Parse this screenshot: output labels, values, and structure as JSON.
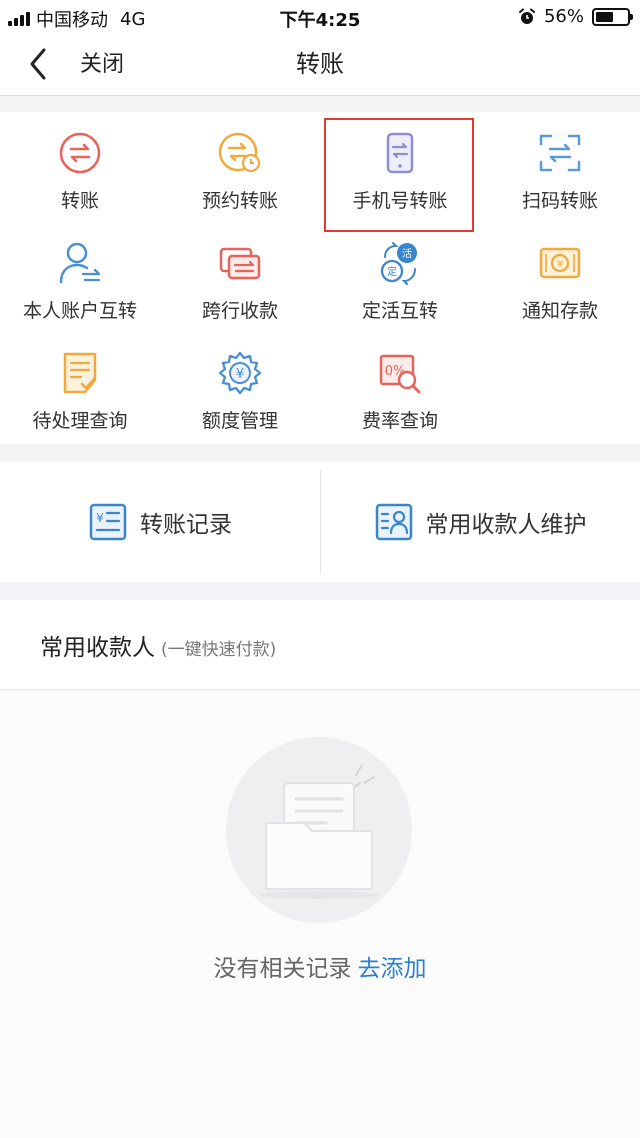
{
  "status_bar": {
    "carrier": "中国移动",
    "network": "4G",
    "time": "下午4:25",
    "battery": "56%",
    "battery_level": 0.56
  },
  "nav": {
    "back_icon": "chevron-left-icon",
    "close_label": "关闭",
    "title": "转账"
  },
  "grid": {
    "items": [
      {
        "label": "转账",
        "icon": "transfer-icon",
        "color": "#e8635a"
      },
      {
        "label": "预约转账",
        "icon": "scheduled-transfer-icon",
        "color": "#f0a93a"
      },
      {
        "label": "手机号转账",
        "icon": "phone-transfer-icon",
        "color": "#8f8fd0"
      },
      {
        "label": "扫码转账",
        "icon": "scan-transfer-icon",
        "color": "#5a9ad8"
      },
      {
        "label": "本人账户互转",
        "icon": "own-account-transfer-icon",
        "color": "#4a8fd4"
      },
      {
        "label": "跨行收款",
        "icon": "interbank-collection-icon",
        "color": "#e8635a"
      },
      {
        "label": "定活互转",
        "icon": "fixed-current-transfer-icon",
        "color": "#3a86cc"
      },
      {
        "label": "通知存款",
        "icon": "notice-deposit-icon",
        "color": "#f0a93a"
      },
      {
        "label": "待处理查询",
        "icon": "pending-query-icon",
        "color": "#f0a93a"
      },
      {
        "label": "额度管理",
        "icon": "limit-management-icon",
        "color": "#4a8fd4"
      },
      {
        "label": "费率查询",
        "icon": "rate-query-icon",
        "color": "#e8635a"
      }
    ],
    "highlighted_index": 2,
    "highlight_color": "#e23a32"
  },
  "actions": {
    "records_label": "转账记录",
    "records_icon": "transfer-record-icon",
    "payee_manage_label": "常用收款人维护",
    "payee_manage_icon": "payee-manage-icon"
  },
  "payees": {
    "title": "常用收款人",
    "subtitle": "(一键快速付款)",
    "empty_text": "没有相关记录",
    "add_label": "去添加",
    "empty_icon": "empty-folder-icon"
  },
  "colors": {
    "accent_blue": "#2d7fcf",
    "red": "#e8635a",
    "orange": "#f0a93a",
    "purple": "#8f8fd0"
  }
}
